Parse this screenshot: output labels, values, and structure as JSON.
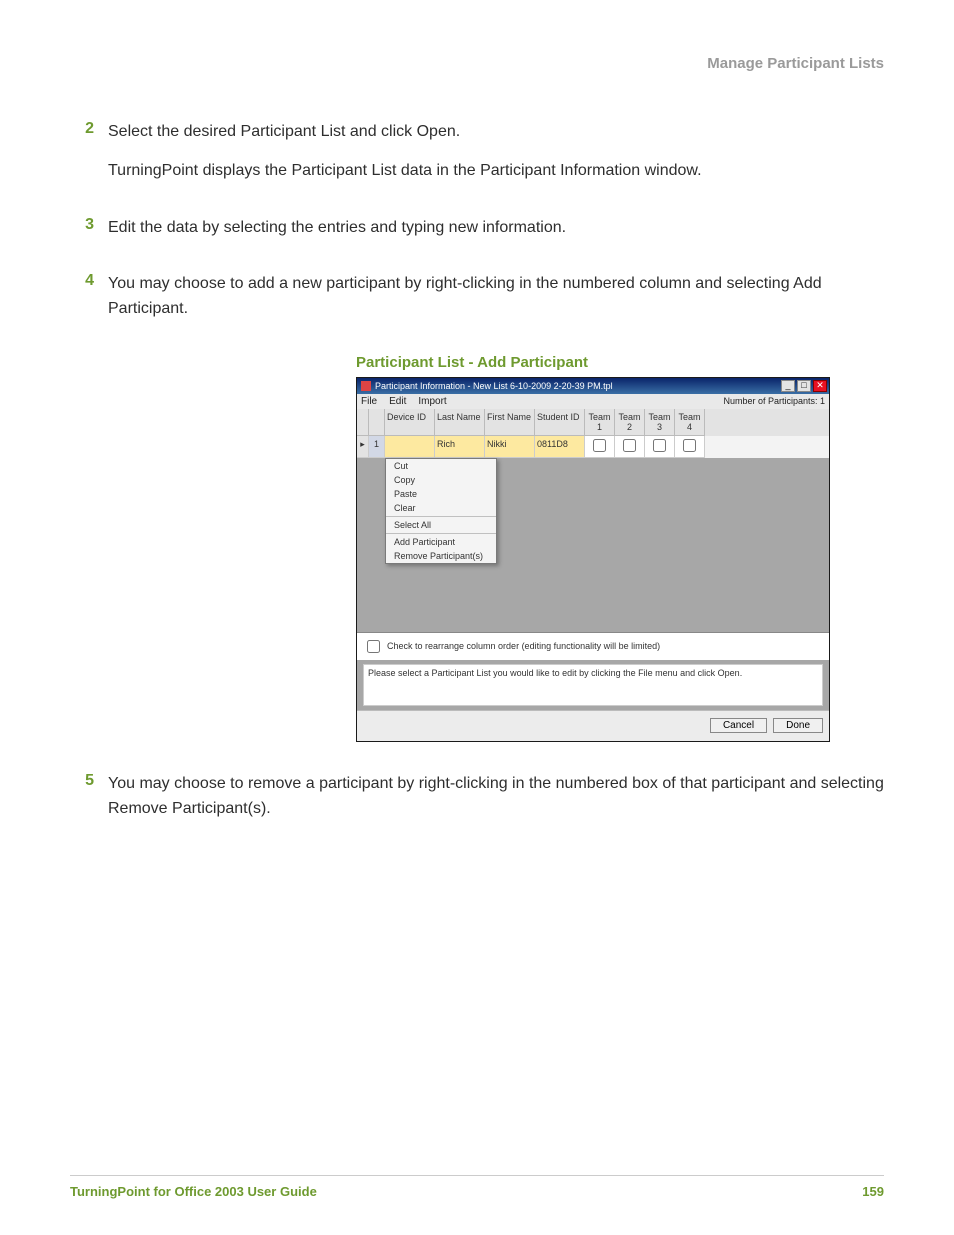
{
  "header": {
    "running_head": "Manage Participant Lists"
  },
  "steps": [
    {
      "num": "2",
      "paras": [
        "Select the desired Participant List and click Open.",
        "TurningPoint displays the Participant List data in the Participant Information window."
      ]
    },
    {
      "num": "3",
      "paras": [
        "Edit the data by selecting the entries and typing new information."
      ]
    },
    {
      "num": "4",
      "paras": [
        "You may choose to add a new participant by right-clicking in the numbered column and selecting Add Participant."
      ]
    },
    {
      "num": "5",
      "paras": [
        "You may choose to remove a participant by right-clicking in the numbered box of that participant and selecting Remove Participant(s)."
      ]
    }
  ],
  "figure": {
    "caption": "Participant List - Add Participant",
    "window": {
      "title": "Participant Information - New List 6-10-2009 2-20-39 PM.tpl",
      "menu": {
        "file": "File",
        "edit": "Edit",
        "import": "Import"
      },
      "participants_label": "Number of Participants: 1",
      "columns": {
        "device_id": "Device ID",
        "last_name": "Last Name",
        "first_name": "First Name",
        "student_id": "Student ID",
        "team1": "Team 1",
        "team2": "Team 2",
        "team3": "Team 3",
        "team4": "Team 4"
      },
      "row1": {
        "num": "1",
        "device_id": "",
        "last_name": "Rich",
        "first_name": "Nikki",
        "student_id": "0811D8"
      },
      "context_menu": {
        "cut": "Cut",
        "copy": "Copy",
        "paste": "Paste",
        "clear": "Clear",
        "select_all": "Select All",
        "add": "Add Participant",
        "remove": "Remove Participant(s)"
      },
      "rearrange_label": "Check to rearrange column order (editing functionality will be limited)",
      "hint": "Please select a Participant List you would like to edit by clicking the File menu and click Open.",
      "buttons": {
        "cancel": "Cancel",
        "done": "Done"
      }
    }
  },
  "footer": {
    "left": "TurningPoint for Office 2003 User Guide",
    "page": "159"
  }
}
